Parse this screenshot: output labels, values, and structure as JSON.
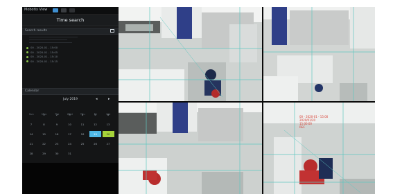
{
  "app": {
    "title": "Mobotix View"
  },
  "header": {
    "title": "Time search"
  },
  "sections": {
    "results_label": "Search results",
    "calendar_label": "Calendar"
  },
  "timestamps": [
    "00 - 2020-01 - 15:00",
    "00 - 2020-01 - 15:05",
    "00 - 2020-01 - 15:10",
    "00 - 2020-01 - 15:15"
  ],
  "calendar": {
    "month": "July 2019",
    "weekdays": [
      "Sun",
      "Mon",
      "Tue",
      "Wed",
      "Thu",
      "Fri",
      "Sat"
    ],
    "days": [
      [
        "",
        "1",
        "2",
        "3",
        "4",
        "5",
        "6"
      ],
      [
        "7",
        "8",
        "9",
        "10",
        "11",
        "12",
        "13"
      ],
      [
        "14",
        "15",
        "16",
        "17",
        "18",
        "19",
        "20"
      ],
      [
        "21",
        "22",
        "23",
        "24",
        "25",
        "26",
        "27"
      ],
      [
        "28",
        "29",
        "30",
        "31",
        "",
        "",
        ""
      ]
    ],
    "selected_day": "19",
    "today_day": "20"
  },
  "overlay": {
    "line1": "00 - 2020-01 - 15:00",
    "line2": "2020/01/20",
    "line3": "15:00:00",
    "line4": "REC"
  },
  "colors": {
    "accent": "#4fb8e6",
    "today": "#a6d33a",
    "osd": "#d83a2e"
  }
}
